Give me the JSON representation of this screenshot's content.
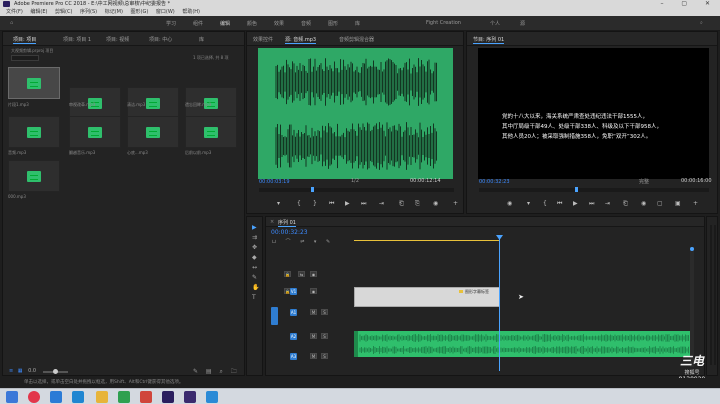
{
  "window": {
    "title": "Adobe Premiere Pro CC 2018 - E:\\中工网视频\\总审核\\中纪委报告 *"
  },
  "menu": [
    "文件(F)",
    "编辑(E)",
    "剪辑(C)",
    "序列(S)",
    "标记(M)",
    "图形(G)",
    "窗口(W)",
    "帮助(H)"
  ],
  "workspaces": [
    "学习",
    "组件",
    "编辑",
    "颜色",
    "效果",
    "音频",
    "图形",
    "库",
    "Fight Creation",
    "个人",
    "源"
  ],
  "project": {
    "tabs": [
      "项目: 项目",
      "项目: 项目 1",
      "项目: 视频",
      "项目: 中心",
      "库"
    ],
    "path": "大视频剪辑.prproj 项目",
    "count": "1 项已选择, 共 8 项",
    "items": [
      {
        "name": "片段1.mp3",
        "dur": "0:02:00"
      },
      {
        "name": "审视改革.mp3",
        "dur": "3:48:00000"
      },
      {
        "name": "清洁.mp3",
        "dur": "1:32:10000"
      },
      {
        "name": "遗忘回眸.mp3",
        "dur": "4:23:0000"
      },
      {
        "name": "音频.mp3",
        "dur": "4:12:0000"
      },
      {
        "name": "翻越音乐.mp3",
        "dur": "2:36:5000"
      },
      {
        "name": "心底...mp3",
        "dur": "4:58:0000"
      },
      {
        "name": "后前以前.mp3",
        "dur": "3:57:0000"
      },
      {
        "name": "000.mp3",
        "dur": "1:01:0000"
      }
    ],
    "footer_zoom": "0.0"
  },
  "source": {
    "tabs": [
      "效果控件",
      "源: 音频.mp3",
      "音频剪辑混合器"
    ],
    "tc_in": "00:00:03:19",
    "tc_out": "00:00:12:14",
    "fit": "1/2"
  },
  "program": {
    "tabs": [
      "节目: 序列 01"
    ],
    "caption_lines": [
      "党的十八大以来，海关系统严肃查处违纪违法干部1555人，",
      "其中厅局级干部49人、处级干部338人、科级及以下干部958人，",
      "其他人员20人；被采取强制措施358人，免职“双开”302人。"
    ],
    "tc_in": "00:00:32:23",
    "fit": "完整",
    "tc_out": "00:00:16:00"
  },
  "timeline": {
    "tab": "序列 01",
    "timecode": "00:00:32:23",
    "clip_label": "图形字幕标签",
    "track_labels": [
      "V3",
      "V2",
      "V1",
      "A1",
      "A2",
      "A3"
    ]
  },
  "status": "单击以选择，或单击空白处并拖拽以框选，用Shift、Alt和Ctrl键获得其他选项。",
  "watermark": {
    "logo": "三电",
    "sub": "搜狐号",
    "id": "8138929"
  },
  "colors": {
    "accent": "#3d8bff",
    "audio_clip": "#2fbf6c",
    "source_wave_bg": "#2fa866",
    "playhead": "#4aa3ff",
    "yellow_line": "#e8c13a"
  }
}
